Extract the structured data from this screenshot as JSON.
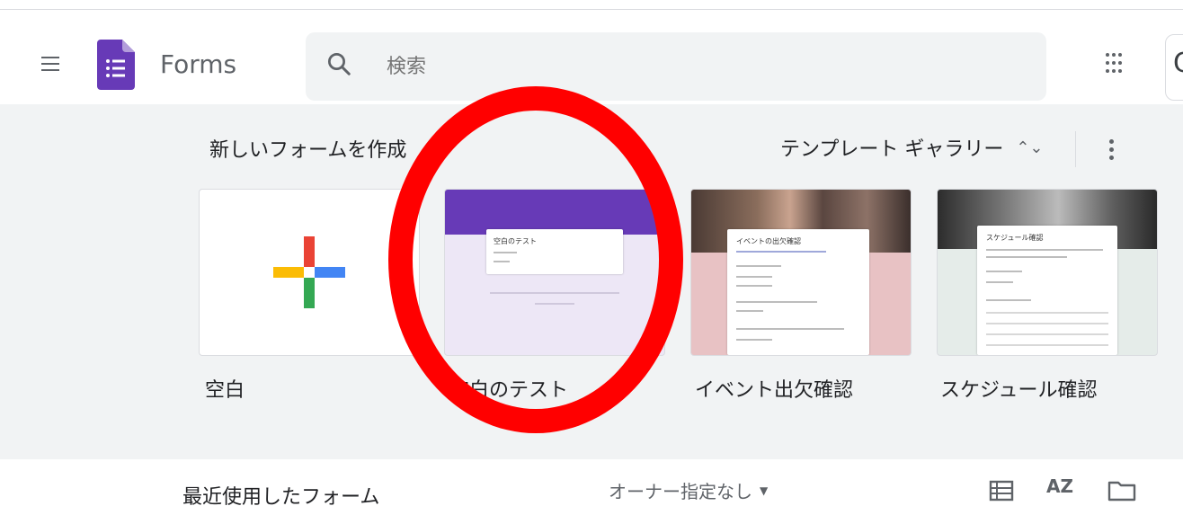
{
  "header": {
    "app_title": "Forms",
    "search_placeholder": "検索",
    "icons": [
      "menu-icon",
      "forms-logo-icon",
      "search-icon",
      "apps-grid-icon",
      "account-icon"
    ],
    "account_glyph": "C"
  },
  "new_form": {
    "section_title": "新しいフォームを作成",
    "gallery_label": "テンプレート ギャラリー",
    "gallery_chevron": "⌃⌄",
    "tiles": [
      {
        "label": "空白"
      },
      {
        "label": "空白のテスト",
        "card_title": "空白のテスト"
      },
      {
        "label": "イベント出欠確認",
        "card_title": "イベントの出欠確認"
      },
      {
        "label": "スケジュール確認",
        "card_title": "スケジュール確認"
      }
    ]
  },
  "recent": {
    "title": "最近使用したフォーム",
    "owner_filter": "オーナー指定なし",
    "owner_caret": "▼",
    "sort_label": "AZ"
  },
  "colors": {
    "forms_purple": "#673ab7",
    "gray_bg": "#f1f3f4",
    "annotation_red": "#ff0000"
  }
}
